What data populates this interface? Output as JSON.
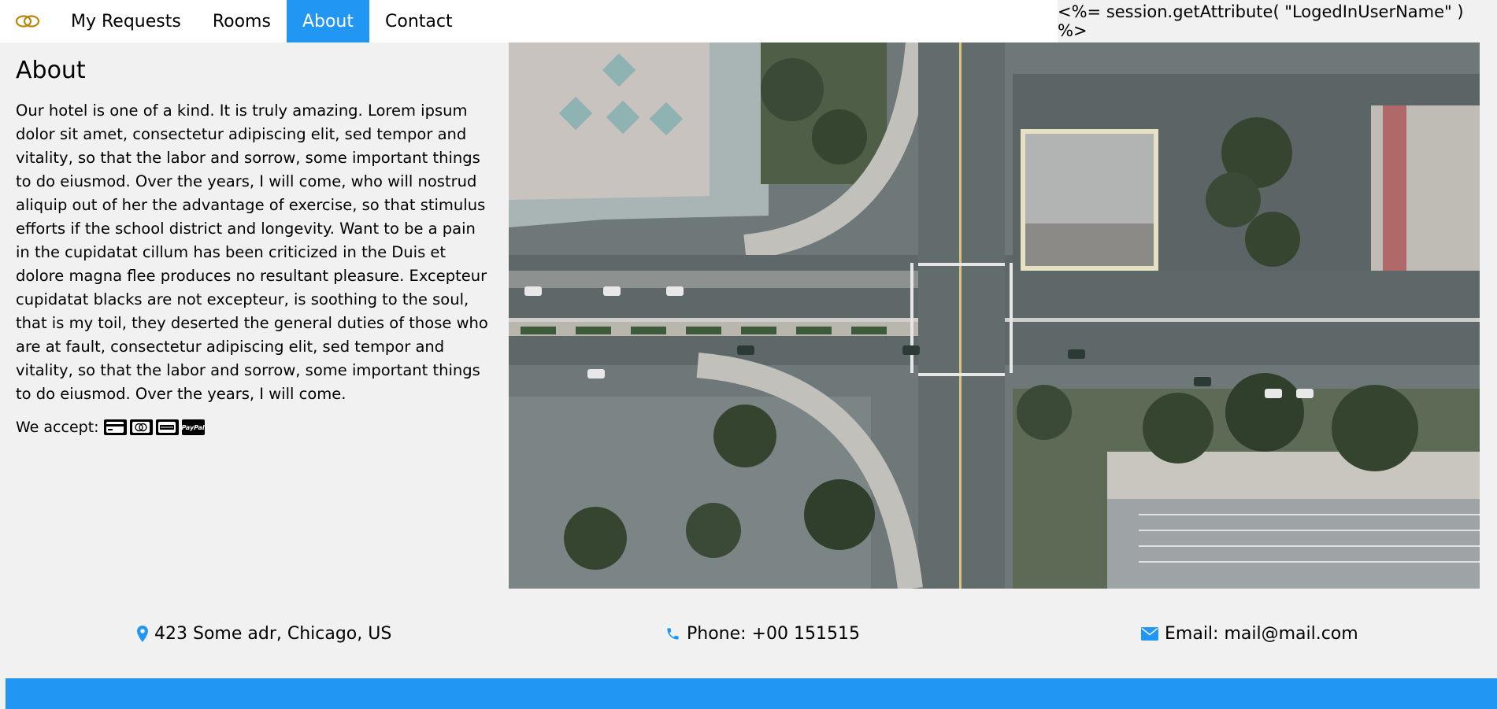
{
  "nav": {
    "items": [
      {
        "label": "My Requests"
      },
      {
        "label": "Rooms"
      },
      {
        "label": "About"
      },
      {
        "label": "Contact"
      }
    ],
    "active": "About",
    "user_label": "<%= session.getAttribute( \"LogedInUserName\" ) %>"
  },
  "about": {
    "title": "About",
    "body": "Our hotel is one of a kind. It is truly amazing. Lorem ipsum dolor sit amet, consectetur adipiscing elit, sed tempor and vitality, so that the labor and sorrow, some important things to do eiusmod. Over the years, I will come, who will nostrud aliquip out of her the advantage of exercise, so that stimulus efforts if the school district and longevity. Want to be a pain in the cupidatat cillum has been criticized in the Duis et dolore magna flee produces no resultant pleasure. Excepteur cupidatat blacks are not excepteur, is soothing to the soul, that is my toil, they deserted the general duties of those who are at fault, consectetur adipiscing elit, sed tempor and vitality, so that the labor and sorrow, some important things to do eiusmod. Over the years, I will come.",
    "accept_label": "We accept:",
    "paypal_text": "PayPal"
  },
  "contact": {
    "address": "423 Some adr, Chicago, US",
    "phone": "Phone: +00 151515",
    "email": "Email: mail@mail.com"
  },
  "colors": {
    "accent": "#2196F3",
    "logo": "#b8860b",
    "background": "#f1f1f1"
  },
  "icons": [
    "logo-icon",
    "credit-card-icon",
    "mastercard-icon",
    "amex-icon",
    "paypal-icon",
    "map-marker-icon",
    "phone-icon",
    "envelope-icon"
  ]
}
